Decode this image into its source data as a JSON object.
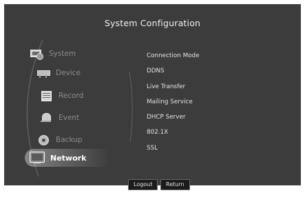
{
  "window": {
    "title": "System Configuration"
  },
  "sidebar": {
    "items": [
      {
        "label": "System",
        "icon": "system-icon"
      },
      {
        "label": "Device",
        "icon": "device-icon"
      },
      {
        "label": "Record",
        "icon": "record-icon"
      },
      {
        "label": "Event",
        "icon": "event-icon"
      },
      {
        "label": "Backup",
        "icon": "backup-icon"
      },
      {
        "label": "Network",
        "icon": "network-icon",
        "selected": true
      }
    ]
  },
  "submenu": {
    "items": [
      {
        "label": "Connection Mode"
      },
      {
        "label": "DDNS"
      },
      {
        "label": "Live Transfer"
      },
      {
        "label": "Mailing Service"
      },
      {
        "label": "DHCP Server"
      },
      {
        "label": "802.1X"
      },
      {
        "label": "SSL"
      }
    ]
  },
  "footer": {
    "logout_label": "Logout",
    "return_label": "Return"
  },
  "colors": {
    "background": "#3c3c3c",
    "active_text": "#ffffff",
    "inactive_text": "#8d8d8d",
    "menu_text": "#e4e4e4"
  }
}
